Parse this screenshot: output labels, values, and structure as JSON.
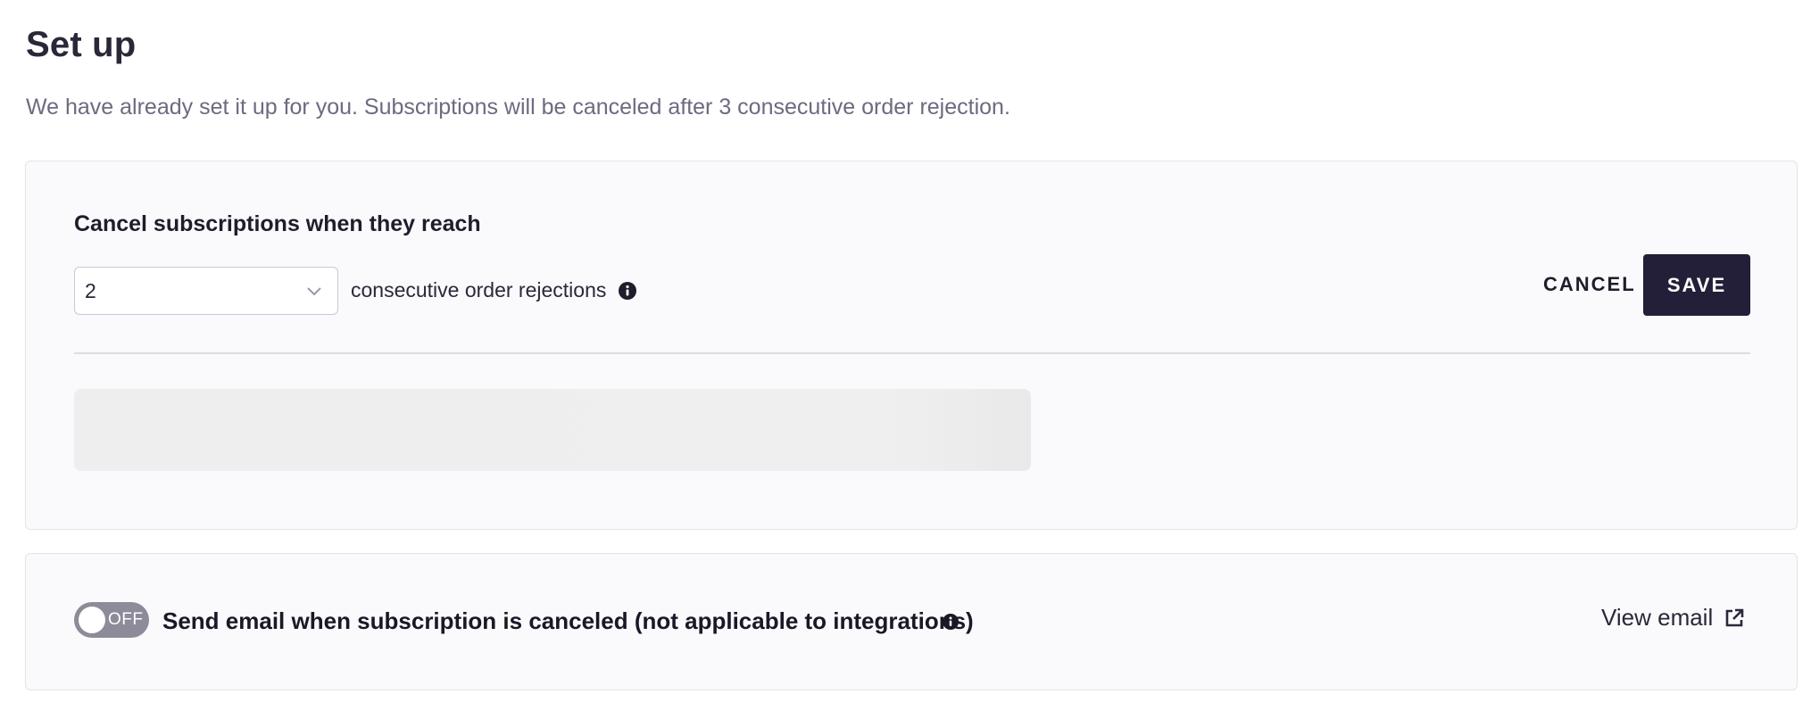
{
  "header": {
    "title": "Set up",
    "description": "We have already set it up for you. Subscriptions will be canceled after 3 consecutive order rejection."
  },
  "rule": {
    "heading": "Cancel subscriptions when they reach",
    "select_value": "2",
    "suffix": "consecutive order rejections",
    "cancel_label": "CANCEL",
    "save_label": "SAVE"
  },
  "email": {
    "toggle_state": "OFF",
    "label": "Send email when subscription is canceled (not applicable to integrations)",
    "view_label": "View email"
  },
  "icons": {
    "chevron": "chevron-down-icon",
    "info": "info-icon",
    "external": "external-link-icon"
  },
  "colors": {
    "primary_button": "#231f38",
    "toggle_off": "#8d8b99",
    "card_background": "#fafafc"
  }
}
